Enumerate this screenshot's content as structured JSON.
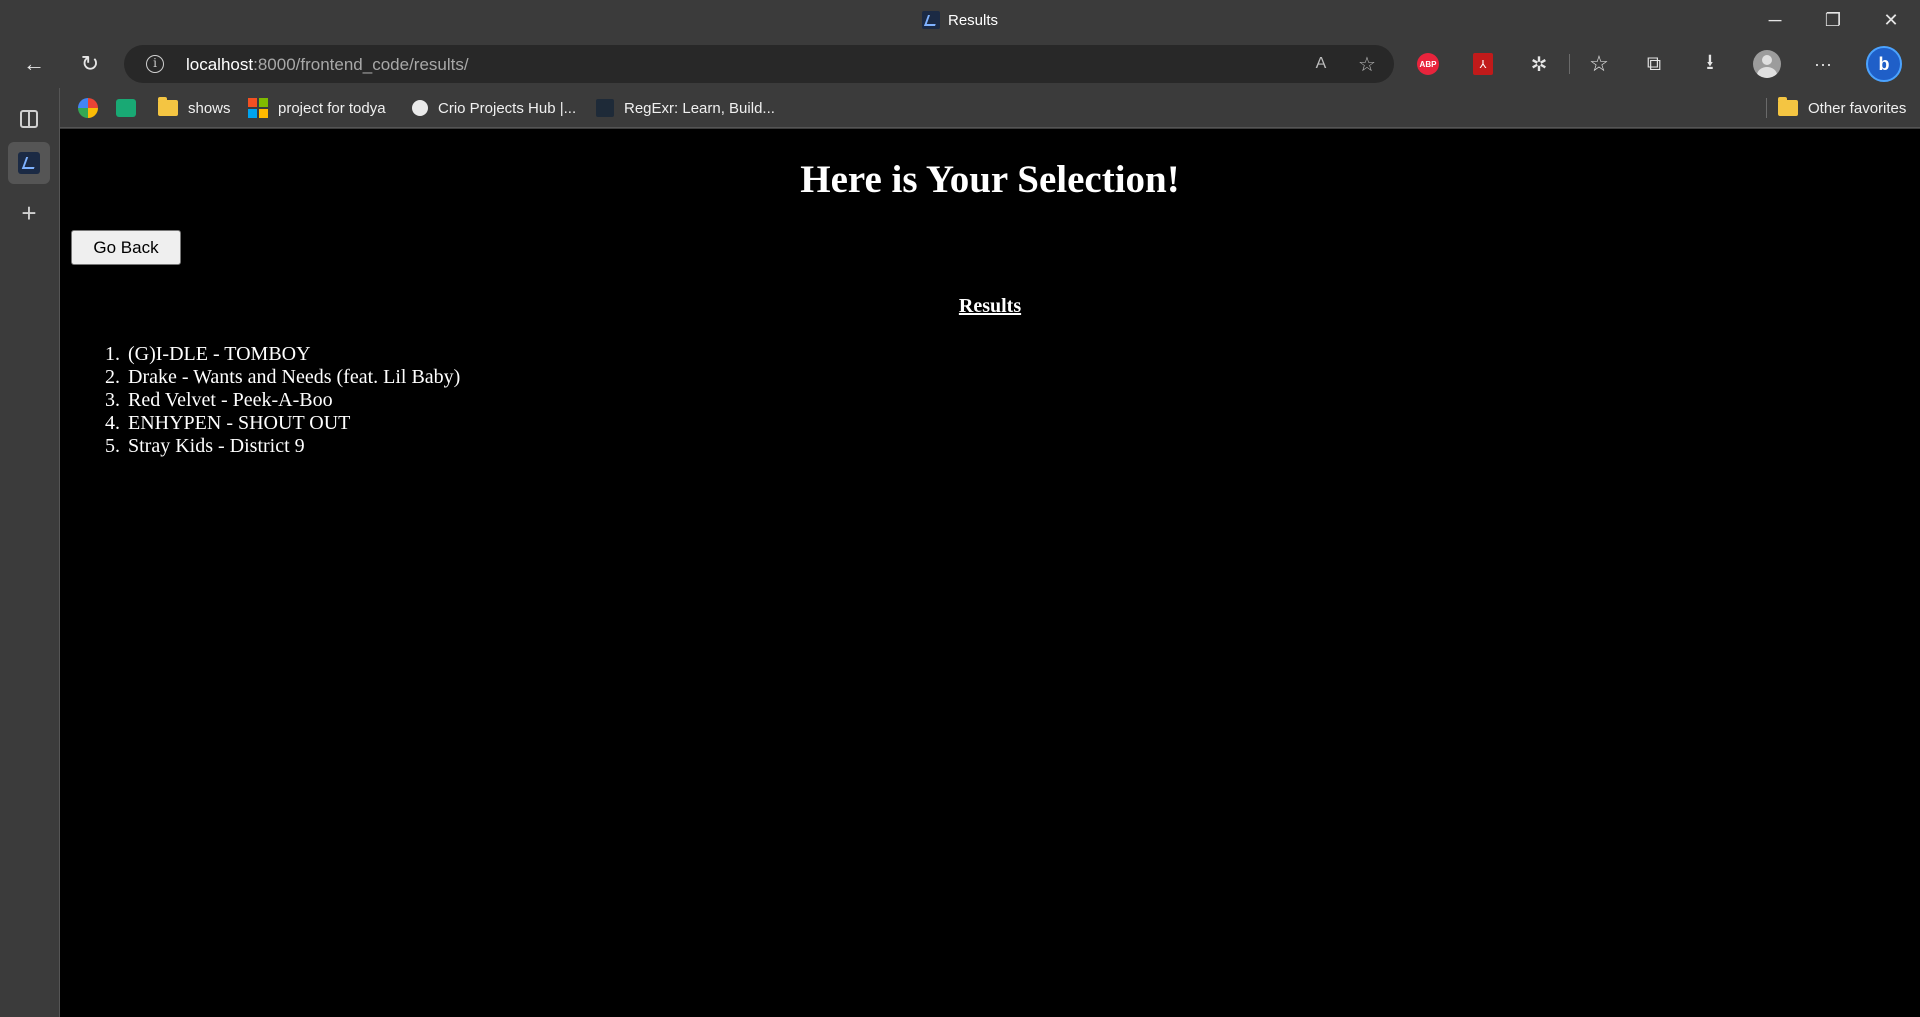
{
  "window": {
    "title": "Results",
    "minimize_glyph": "─",
    "restore_glyph": "❐",
    "close_glyph": "✕"
  },
  "toolbar": {
    "back_glyph": "←",
    "refresh_glyph": "↻",
    "info_glyph": "i",
    "url_host": "localhost",
    "url_rest": ":8000/frontend_code/results/",
    "read_aloud_glyph": "A",
    "add_favorite_glyph": "☆",
    "abp_label": "ABP",
    "pdf_glyph": "⅄",
    "extensions_glyph": "✲",
    "favorites_glyph": "☆",
    "collections_glyph": "⧉",
    "downloads_glyph": "⭳",
    "menu_glyph": "···",
    "bing_label": "b"
  },
  "favorites": {
    "items": [
      {
        "label": "shows",
        "icon": "folder-icon"
      },
      {
        "label": "project for todya",
        "icon": "microsoft-icon"
      },
      {
        "label": "Crio Projects Hub |...",
        "icon": "crio-icon"
      },
      {
        "label": "RegExr: Learn, Build...",
        "icon": "regexr-icon"
      }
    ],
    "other": "Other favorites"
  },
  "sidebar": {
    "new_tab_glyph": "+"
  },
  "page": {
    "heading": "Here is Your Selection!",
    "go_back": "Go Back",
    "results_heading": "Results",
    "results": [
      {
        "num": "1.",
        "text": "(G)I-DLE - TOMBOY"
      },
      {
        "num": "2.",
        "text": "Drake - Wants and Needs (feat. Lil Baby)"
      },
      {
        "num": "3.",
        "text": "Red Velvet - Peek-A-Boo"
      },
      {
        "num": "4.",
        "text": "ENHYPEN - SHOUT OUT"
      },
      {
        "num": "5.",
        "text": "Stray Kids - District 9"
      }
    ]
  },
  "colors": {
    "page_bg": "#000000",
    "chrome_bg": "#3b3b3b",
    "address_bg": "#282828",
    "abp_red": "#e8243c",
    "pdf_red": "#c11a1a",
    "bing_blue": "#1f5fc8"
  }
}
